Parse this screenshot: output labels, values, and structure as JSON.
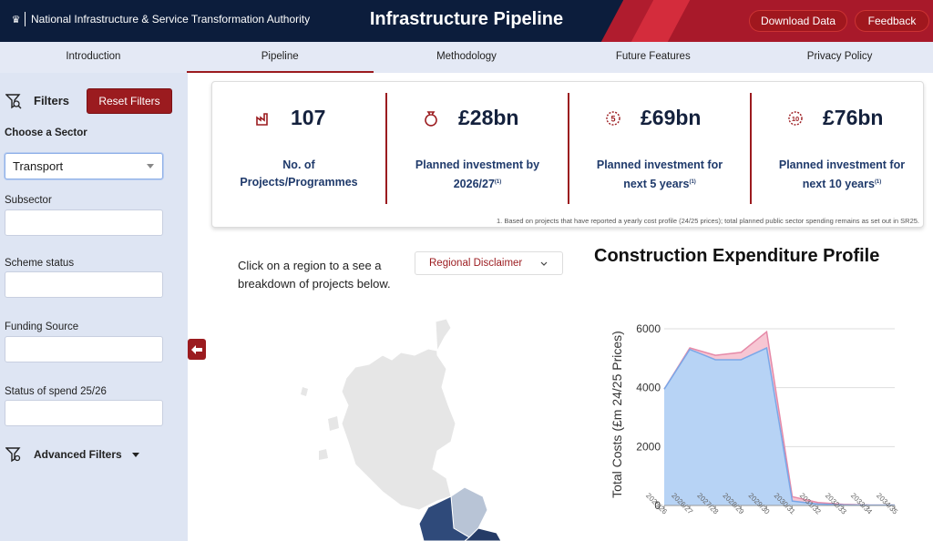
{
  "header": {
    "org_name": "National Infrastructure & Service Transformation Authority",
    "title": "Infrastructure Pipeline",
    "download_label": "Download Data",
    "feedback_label": "Feedback"
  },
  "nav": {
    "tabs": [
      {
        "label": "Introduction",
        "active": false
      },
      {
        "label": "Pipeline",
        "active": true
      },
      {
        "label": "Methodology",
        "active": false
      },
      {
        "label": "Future Features",
        "active": false
      },
      {
        "label": "Privacy Policy",
        "active": false
      }
    ]
  },
  "sidebar": {
    "filters_label": "Filters",
    "reset_label": "Reset Filters",
    "sector_label": "Choose a Sector",
    "sector_value": "Transport",
    "subsector_label": "Subsector",
    "scheme_status_label": "Scheme status",
    "funding_source_label": "Funding Source",
    "spend_status_label": "Status of spend 25/26",
    "advanced_label": "Advanced Filters"
  },
  "stats": [
    {
      "value": "107",
      "desc1": "No. of",
      "desc2": "Projects/Programmes",
      "sup": "",
      "icon": "factory-icon"
    },
    {
      "value": "£28bn",
      "desc1": "Planned investment by",
      "desc2": "2026/27",
      "sup": "(1)",
      "icon": "money-bag-icon"
    },
    {
      "value": "£69bn",
      "desc1": "Planned investment for",
      "desc2": "next 5 years",
      "sup": "(1)",
      "icon": "five-icon"
    },
    {
      "value": "£76bn",
      "desc1": "Planned investment for",
      "desc2": "next 10 years",
      "sup": "(1)",
      "icon": "ten-icon"
    }
  ],
  "footnote": "1. Based on projects that have reported a yearly cost profile (24/25 prices); total planned public sector spending remains as set out in SR25.",
  "map": {
    "instruction": "Click on a region to a see a breakdown of projects below.",
    "disclaimer_label": "Regional Disclaimer"
  },
  "colors": {
    "accent": "#9b1b1f",
    "navy": "#0c1d3c",
    "blue_area": "#b7d3f5",
    "pink_area": "#f7c6d3"
  },
  "chart_data": {
    "type": "area",
    "title": "Construction Expenditure Profile",
    "ylabel": "Total Costs (£m 24/25 Prices)",
    "xlabel": "",
    "categories": [
      "2025/26",
      "2026/27",
      "2027/28",
      "2028/29",
      "2029/30",
      "2030/31",
      "2031/32",
      "2032/33",
      "2033/34",
      "2034/35"
    ],
    "y_ticks": [
      "0",
      "2000",
      "4000",
      "6000"
    ],
    "ylim": [
      0,
      6000
    ],
    "series": [
      {
        "values": [
          3950,
          5300,
          4950,
          4950,
          5350,
          150,
          50,
          20,
          10,
          10
        ],
        "color": "#b7d3f5"
      },
      {
        "values": [
          3950,
          5350,
          5100,
          5200,
          5900,
          300,
          100,
          40,
          15,
          10
        ],
        "color": "#f7c6d3"
      }
    ],
    "grid": true
  }
}
